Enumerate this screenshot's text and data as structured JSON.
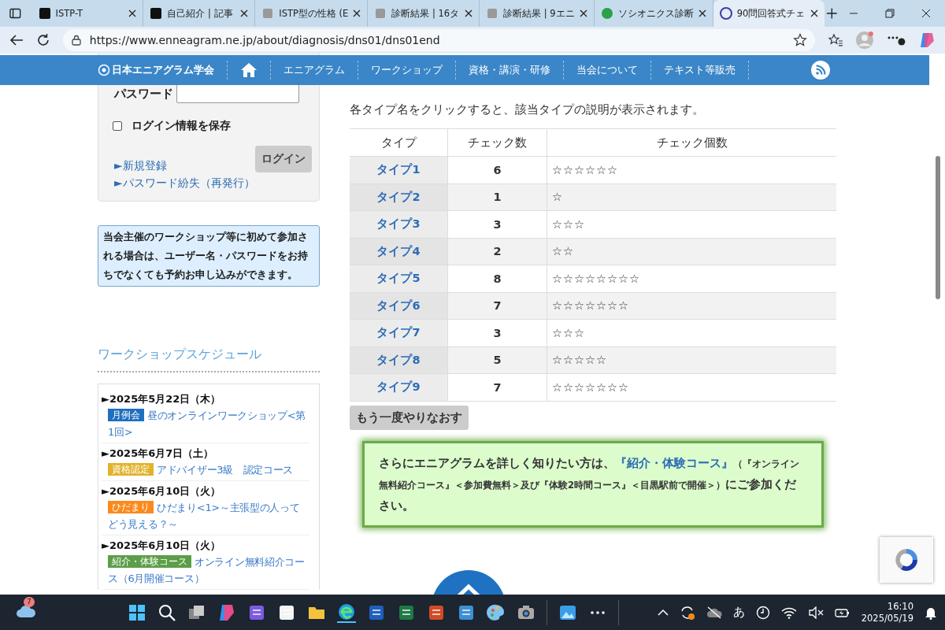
{
  "browser": {
    "tabs": [
      {
        "title": "ISTP-T",
        "selected": false
      },
      {
        "title": "自己紹介 | 記事",
        "selected": false
      },
      {
        "title": "ISTP型の性格 (E",
        "selected": false
      },
      {
        "title": "診断結果 | 16タ",
        "selected": false
      },
      {
        "title": "診断結果 | 9エニ",
        "selected": false
      },
      {
        "title": "ソシオニクス診断",
        "selected": false
      },
      {
        "title": "90問回答式チェ",
        "selected": true
      }
    ],
    "address": "https://www.enneagram.ne.jp/about/diagnosis/dns01/dns01end"
  },
  "header": {
    "logo": "日本エニアグラム学会",
    "nav": [
      "エニアグラム",
      "ワークショップ",
      "資格・講演・研修",
      "当会について",
      "テキスト等販売"
    ]
  },
  "login": {
    "password_label": "パスワード",
    "remember": {
      "label": "ログイン情報を保存",
      "checked": false
    },
    "button": "ログイン",
    "links": [
      "►新規登録",
      "►パスワード紛失（再発行）"
    ]
  },
  "notice": "当会主催のワークショップ等に初めて参加される場合は、ユーザー名・パスワードをお持ちでなくても予約お申し込みができます。",
  "schedule": {
    "title": "ワークショップスケジュール",
    "items": [
      {
        "date": "►2025年5月22日（木）",
        "tag": "月例会",
        "color": "#1f6fbf",
        "title": "昼のオンラインワークショップ<第1回>"
      },
      {
        "date": "►2025年6月7日（土）",
        "tag": "資格認定",
        "color": "#e2b22c",
        "title": "アドバイザー3級　認定コース"
      },
      {
        "date": "►2025年6月10日（火）",
        "tag": "ひだまり",
        "color": "#fb8a1c",
        "title": "ひだまり<1>～主張型の人ってどう見える？～"
      },
      {
        "date": "►2025年6月10日（火）",
        "tag": "紹介・体験コース",
        "color": "#5c9e48",
        "title": "オンライン無料紹介コース（6月開催コース）"
      }
    ]
  },
  "instruction": "各タイプ名をクリックすると、該当タイプの説明が表示されます。",
  "table": {
    "columns": [
      "タイプ",
      "チェック数",
      "チェック個数"
    ],
    "rows": [
      {
        "type": "タイプ1",
        "count": "6",
        "stars": "☆☆☆☆☆☆"
      },
      {
        "type": "タイプ2",
        "count": "1",
        "stars": "☆"
      },
      {
        "type": "タイプ3",
        "count": "3",
        "stars": "☆☆☆"
      },
      {
        "type": "タイプ4",
        "count": "2",
        "stars": "☆☆"
      },
      {
        "type": "タイプ5",
        "count": "8",
        "stars": "☆☆☆☆☆☆☆☆"
      },
      {
        "type": "タイプ6",
        "count": "7",
        "stars": "☆☆☆☆☆☆☆"
      },
      {
        "type": "タイプ7",
        "count": "3",
        "stars": "☆☆☆"
      },
      {
        "type": "タイプ8",
        "count": "5",
        "stars": "☆☆☆☆☆"
      },
      {
        "type": "タイプ9",
        "count": "7",
        "stars": "☆☆☆☆☆☆☆"
      }
    ]
  },
  "retry_button": "もう一度やりなおす",
  "promo": {
    "lead": "さらにエニアグラムを詳しく知りたい方は、",
    "link": "『紹介・体験コース』",
    "note": "（『オンライン無料紹介コース』＜参加費無料＞及び『体験2時間コース』＜目黒駅前で開催＞）",
    "tail": "にご参加ください。"
  },
  "taskbar": {
    "weather_badge": "7",
    "ime": "あ",
    "time": "16:10",
    "date": "2025/05/19"
  }
}
